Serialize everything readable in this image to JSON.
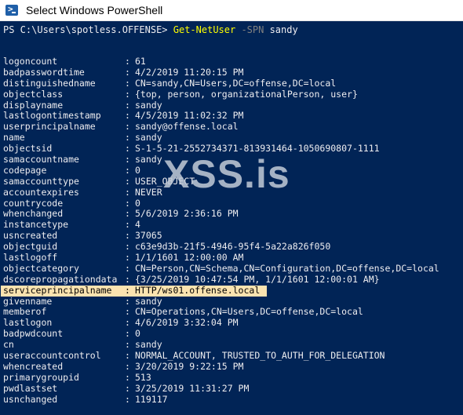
{
  "window": {
    "title": "Select Windows PowerShell",
    "icon": "powershell-icon"
  },
  "console": {
    "prompt": "PS C:\\Users\\spotless.OFFENSE> ",
    "command": "Get-NetUser",
    "parameter": " -SPN",
    "argument": " sandy",
    "highlight_color": "#fbe3b0",
    "background_color": "#012456"
  },
  "watermark": "XSS.is",
  "properties": [
    {
      "key": "logoncount",
      "value": "61"
    },
    {
      "key": "badpasswordtime",
      "value": "4/2/2019 11:20:15 PM"
    },
    {
      "key": "distinguishedname",
      "value": "CN=sandy,CN=Users,DC=offense,DC=local"
    },
    {
      "key": "objectclass",
      "value": "{top, person, organizationalPerson, user}"
    },
    {
      "key": "displayname",
      "value": "sandy"
    },
    {
      "key": "lastlogontimestamp",
      "value": "4/5/2019 11:02:32 PM"
    },
    {
      "key": "userprincipalname",
      "value": "sandy@offense.local"
    },
    {
      "key": "name",
      "value": "sandy"
    },
    {
      "key": "objectsid",
      "value": "S-1-5-21-2552734371-813931464-1050690807-1111"
    },
    {
      "key": "samaccountname",
      "value": "sandy"
    },
    {
      "key": "codepage",
      "value": "0"
    },
    {
      "key": "samaccounttype",
      "value": "USER_OBJECT"
    },
    {
      "key": "accountexpires",
      "value": "NEVER"
    },
    {
      "key": "countrycode",
      "value": "0"
    },
    {
      "key": "whenchanged",
      "value": "5/6/2019 2:36:16 PM"
    },
    {
      "key": "instancetype",
      "value": "4"
    },
    {
      "key": "usncreated",
      "value": "37065"
    },
    {
      "key": "objectguid",
      "value": "c63e9d3b-21f5-4946-95f4-5a22a826f050"
    },
    {
      "key": "lastlogoff",
      "value": "1/1/1601 12:00:00 AM"
    },
    {
      "key": "objectcategory",
      "value": "CN=Person,CN=Schema,CN=Configuration,DC=offense,DC=local"
    },
    {
      "key": "dscorepropagationdata",
      "value": "{3/25/2019 10:47:54 PM, 1/1/1601 12:00:01 AM}"
    },
    {
      "key": "serviceprincipalname",
      "value": "HTTP/ws01.offense.local",
      "highlighted": true
    },
    {
      "key": "givenname",
      "value": "sandy"
    },
    {
      "key": "memberof",
      "value": "CN=Operations,CN=Users,DC=offense,DC=local"
    },
    {
      "key": "lastlogon",
      "value": "4/6/2019 3:32:04 PM"
    },
    {
      "key": "badpwdcount",
      "value": "0"
    },
    {
      "key": "cn",
      "value": "sandy"
    },
    {
      "key": "useraccountcontrol",
      "value": "NORMAL_ACCOUNT, TRUSTED_TO_AUTH_FOR_DELEGATION"
    },
    {
      "key": "whencreated",
      "value": "3/20/2019 9:22:15 PM"
    },
    {
      "key": "primarygroupid",
      "value": "513"
    },
    {
      "key": "pwdlastset",
      "value": "3/25/2019 11:31:27 PM"
    },
    {
      "key": "usnchanged",
      "value": "119117"
    }
  ]
}
